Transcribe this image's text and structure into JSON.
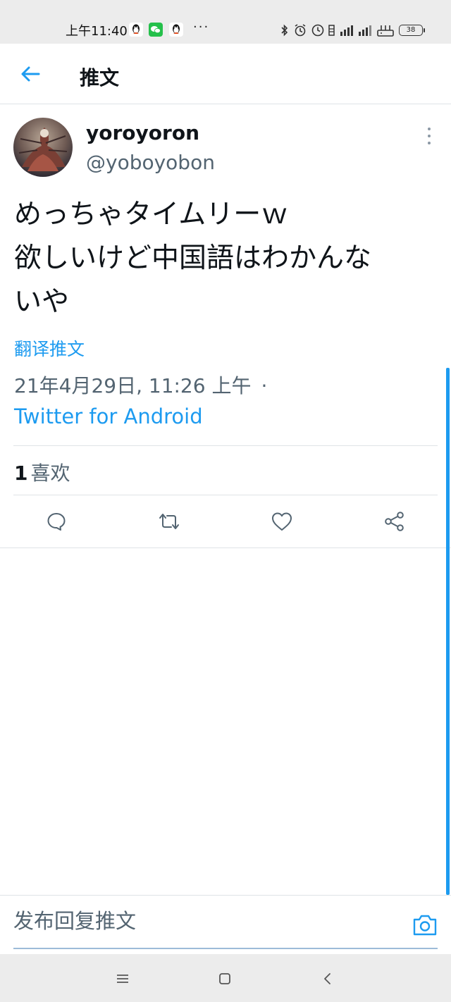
{
  "status_bar": {
    "time": "上午11:40",
    "more": "···",
    "battery": "38",
    "apps": [
      "qq-icon",
      "wechat-icon",
      "qq-icon"
    ]
  },
  "header": {
    "title": "推文",
    "back_icon": "arrow-left-icon"
  },
  "tweet": {
    "display_name": "yoroyoron",
    "handle": "@yoboyobon",
    "text_lines": [
      "めっちゃタイムリーｗ",
      "欲しいけど中国語はわかんな",
      "いや"
    ],
    "translate_label": "翻译推文",
    "timestamp": "21年4月29日, 11:26 上午",
    "timestamp_separator": "·",
    "source": "Twitter for Android",
    "likes_count": "1",
    "likes_label": "喜欢"
  },
  "actions": [
    {
      "name": "reply-button",
      "icon": "comment-icon"
    },
    {
      "name": "retweet-button",
      "icon": "retweet-icon"
    },
    {
      "name": "like-button",
      "icon": "heart-icon"
    },
    {
      "name": "share-button",
      "icon": "share-icon"
    }
  ],
  "reply": {
    "placeholder": "发布回复推文",
    "camera_icon": "camera-icon"
  },
  "nav_bar": {
    "buttons": [
      "menu-icon",
      "home-icon",
      "back-icon"
    ]
  },
  "colors": {
    "accent": "#1d9bf0",
    "secondary_text": "#536471",
    "primary_text": "#0f1419",
    "divider": "#dfe3e6"
  }
}
